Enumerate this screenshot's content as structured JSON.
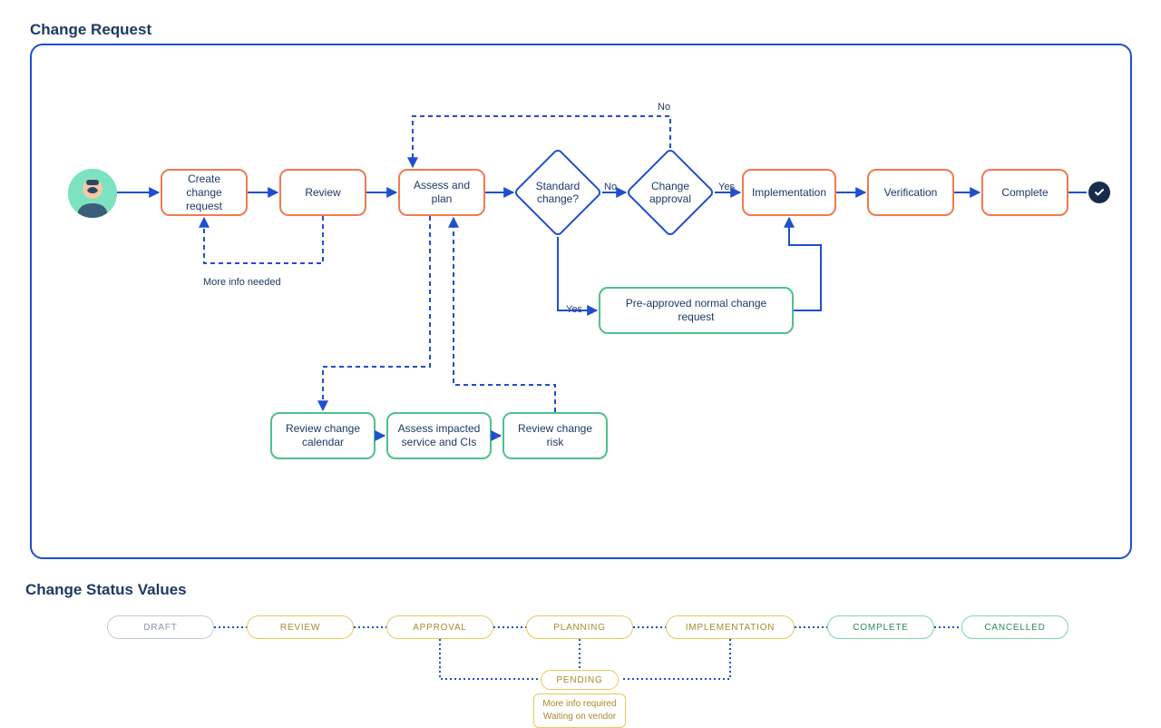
{
  "titles": {
    "change_request": "Change Request",
    "change_status_values": "Change Status Values"
  },
  "nodes": {
    "create": "Create change request",
    "review": "Review",
    "assess_plan": "Assess and plan",
    "standard_q": "Standard change?",
    "approval": "Change approval",
    "implementation": "Implementation",
    "verification": "Verification",
    "complete": "Complete",
    "preapproved": "Pre-approved normal change request",
    "rev_calendar": "Review change calendar",
    "rev_impacted": "Assess impacted service and CIs",
    "rev_risk": "Review change risk"
  },
  "labels": {
    "no_top": "No",
    "no_mid": "No",
    "yes_mid": "Yes",
    "yes_down": "Yes",
    "more_info": "More info needed"
  },
  "status": {
    "draft": "DRAFT",
    "review": "REVIEW",
    "approval": "APPROVAL",
    "planning": "PLANNING",
    "implementation": "IMPLEMENTATION",
    "complete": "COMPLETE",
    "cancelled": "CANCELLED",
    "pending": "PENDING",
    "pending_note1": "More info required",
    "pending_note2": "Waiting on vendor"
  }
}
